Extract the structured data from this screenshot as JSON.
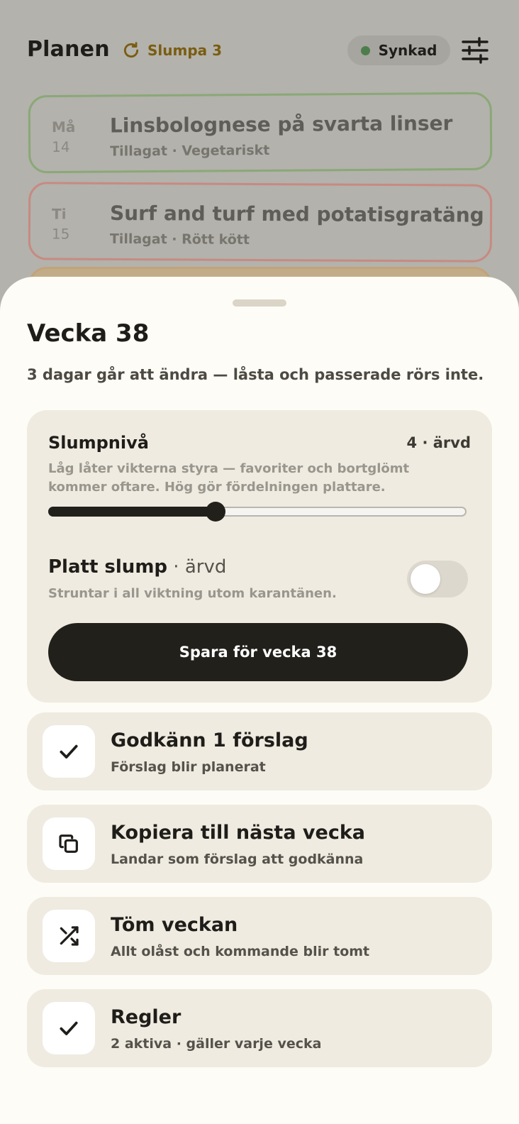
{
  "header": {
    "title": "Planen",
    "shuffle_label": "Slumpa 3",
    "sync_label": "Synkad"
  },
  "days": [
    {
      "day": "Må",
      "date": "14",
      "title": "Linsbolognese på svarta linser",
      "subtitle": "Tillagat · Vegetariskt"
    },
    {
      "day": "Ti",
      "date": "15",
      "title": "Surf and turf med potatisgratäng",
      "subtitle": "Tillagat · Rött kött"
    }
  ],
  "sheet": {
    "title": "Vecka 38",
    "subtitle": "3 dagar går att ändra — låsta och passerade rörs inte.",
    "level": {
      "label": "Slumpnivå",
      "value_label": "4 · ärvd",
      "description": "Låg låter vikterna styra — favoriter och bortglömt kommer oftare. Hög gör fördelningen plattare.",
      "fraction": 0.4
    },
    "flat": {
      "label": "Platt slump",
      "inherited": " · ärvd",
      "description": "Struntar i all viktning utom karantänen.",
      "on": false
    },
    "save_label": "Spara för vecka 38",
    "actions": [
      {
        "icon": "check-icon",
        "title": "Godkänn 1 förslag",
        "subtitle": "Förslag blir planerat"
      },
      {
        "icon": "copy-icon",
        "title": "Kopiera till nästa vecka",
        "subtitle": "Landar som förslag att godkänna"
      },
      {
        "icon": "shuffle-icon",
        "title": "Töm veckan",
        "subtitle": "Allt olåst och kommande blir tomt"
      },
      {
        "icon": "check-icon",
        "title": "Regler",
        "subtitle": "2 aktiva · gäller varje vecka"
      }
    ]
  },
  "colors": {
    "accent": "#7a5d12",
    "sync_dot": "#4e7d4d",
    "card_green": "#8aa877",
    "card_red": "#c78a82",
    "dark": "#22201b"
  }
}
